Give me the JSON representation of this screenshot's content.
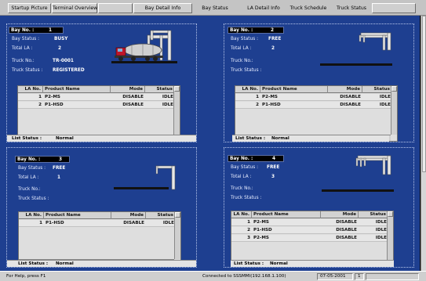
{
  "menu": [
    {
      "label": "Startup Picture",
      "style": "raised"
    },
    {
      "label": "Terminal Overview",
      "style": "raised"
    },
    {
      "label": "",
      "style": "raised"
    },
    {
      "label": "Bay Detail Info",
      "style": "raised"
    },
    {
      "label": "Bay Status",
      "style": "flat"
    },
    {
      "label": "LA Detail Info",
      "style": "flat"
    },
    {
      "label": "Truck Schedule",
      "style": "flat"
    },
    {
      "label": "Truck Status",
      "style": "flat"
    },
    {
      "label": "",
      "style": "raised"
    }
  ],
  "labels": {
    "bay_no": "Bay No. :",
    "bay_status": "Bay Status :",
    "total_la": "Total LA :",
    "truck_no": "Truck No.:",
    "truck_status": "Truck Status :",
    "list_status": "List Status :"
  },
  "grid_headers": {
    "la_no": "LA No.",
    "product": "Product Name",
    "mode": "Mode",
    "status": "Status"
  },
  "bays": [
    {
      "bay_no": "1",
      "bay_status": "BUSY",
      "total_la": "2",
      "truck_no": "TR-0001",
      "truck_status": "REGISTERED",
      "list_status": "Normal",
      "rows": [
        {
          "la_no": "1",
          "product": "P2-MS",
          "mode": "DISABLE",
          "status": "IDLE"
        },
        {
          "la_no": "2",
          "product": "P1-HSD",
          "mode": "DISABLE",
          "status": "IDLE"
        }
      ]
    },
    {
      "bay_no": "2",
      "bay_status": "FREE",
      "total_la": "2",
      "truck_no": "",
      "truck_status": "",
      "list_status": "Normal",
      "rows": [
        {
          "la_no": "1",
          "product": "P2-MS",
          "mode": "DISABLE",
          "status": "IDLE"
        },
        {
          "la_no": "2",
          "product": "P1-HSD",
          "mode": "DISABLE",
          "status": "IDLE"
        }
      ]
    },
    {
      "bay_no": "3",
      "bay_status": "FREE",
      "total_la": "1",
      "truck_no": "",
      "truck_status": "",
      "list_status": "Normal",
      "rows": [
        {
          "la_no": "1",
          "product": "P1-HSD",
          "mode": "DISABLE",
          "status": "IDLE"
        }
      ]
    },
    {
      "bay_no": "4",
      "bay_status": "FREE",
      "total_la": "3",
      "truck_no": "",
      "truck_status": "",
      "list_status": "Normal",
      "rows": [
        {
          "la_no": "1",
          "product": "P2-MS",
          "mode": "DISABLE",
          "status": "IDLE"
        },
        {
          "la_no": "2",
          "product": "P1-HSD",
          "mode": "DISABLE",
          "status": "IDLE"
        },
        {
          "la_no": "3",
          "product": "P2-MS",
          "mode": "DISABLE",
          "status": "IDLE"
        }
      ]
    }
  ],
  "statusbar": {
    "help": "For Help, press F1",
    "connection": "Connected  to  SSSMMI(192.168.1.100)",
    "date": "07-05-2001",
    "page": "1"
  },
  "colors": {
    "background": "#1e3f90",
    "truck_cab": "#c0162a",
    "tank": "#cfcfcf"
  },
  "icons": {
    "loading_arm": "loading-arm-icon",
    "truck": "tanker-truck-icon"
  }
}
